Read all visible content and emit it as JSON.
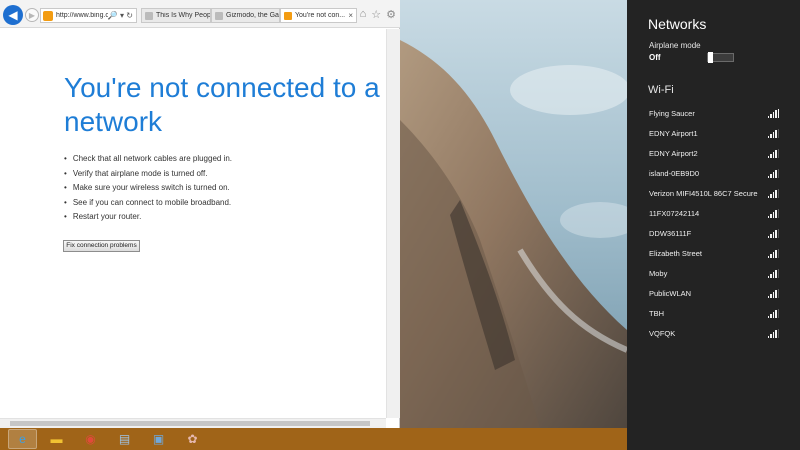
{
  "browser": {
    "url": "http://www.bing.com",
    "address_tools": "🔎 ▾ ↻",
    "tabs": [
      {
        "label": "This Is Why People..."
      },
      {
        "label": "Gizmodo, the Gad..."
      },
      {
        "label": "You're not con...",
        "close": "×"
      }
    ],
    "icons": [
      "home-icon",
      "favorites-star-icon",
      "settings-gear-icon"
    ]
  },
  "page": {
    "title": "You're not connected to a network",
    "steps": [
      "Check that all network cables are plugged in.",
      "Verify that airplane mode is turned off.",
      "Make sure your wireless switch is turned on.",
      "See if you can connect to mobile broadband.",
      "Restart your router."
    ],
    "fix_button": "Fix connection problems"
  },
  "charm": {
    "title": "Networks",
    "airplane_label": "Airplane mode",
    "airplane_state": "Off",
    "wifi_title": "Wi-Fi",
    "networks": [
      {
        "name": "Flying Saucer",
        "signal": 5
      },
      {
        "name": "EDNY Airport1",
        "signal": 4
      },
      {
        "name": "EDNY Airport2",
        "signal": 4
      },
      {
        "name": "island-0EB9D0",
        "signal": 4
      },
      {
        "name": "Verizon MIFI4510L 86C7 Secure",
        "signal": 4
      },
      {
        "name": "11FX07242114",
        "signal": 4
      },
      {
        "name": "DDW36111F",
        "signal": 4
      },
      {
        "name": "Elizabeth Street",
        "signal": 4
      },
      {
        "name": "Moby",
        "signal": 4
      },
      {
        "name": "PublicWLAN",
        "signal": 4
      },
      {
        "name": "TBH",
        "signal": 4
      },
      {
        "name": "VQFQK",
        "signal": 4
      }
    ]
  },
  "taskbar": {
    "items": [
      {
        "name": "internet-explorer-icon",
        "glyph": "e",
        "color": "#3aa0e8",
        "active": true
      },
      {
        "name": "file-explorer-icon",
        "glyph": "▬",
        "color": "#f1c232",
        "active": false
      },
      {
        "name": "chrome-icon",
        "glyph": "◉",
        "color": "#e04a3a",
        "active": false
      },
      {
        "name": "notepad-icon",
        "glyph": "▤",
        "color": "#9fc5e8",
        "active": false
      },
      {
        "name": "remote-desktop-icon",
        "glyph": "▣",
        "color": "#6fa8dc",
        "active": false
      },
      {
        "name": "paint-icon",
        "glyph": "✿",
        "color": "#e6b8af",
        "active": false
      }
    ]
  }
}
